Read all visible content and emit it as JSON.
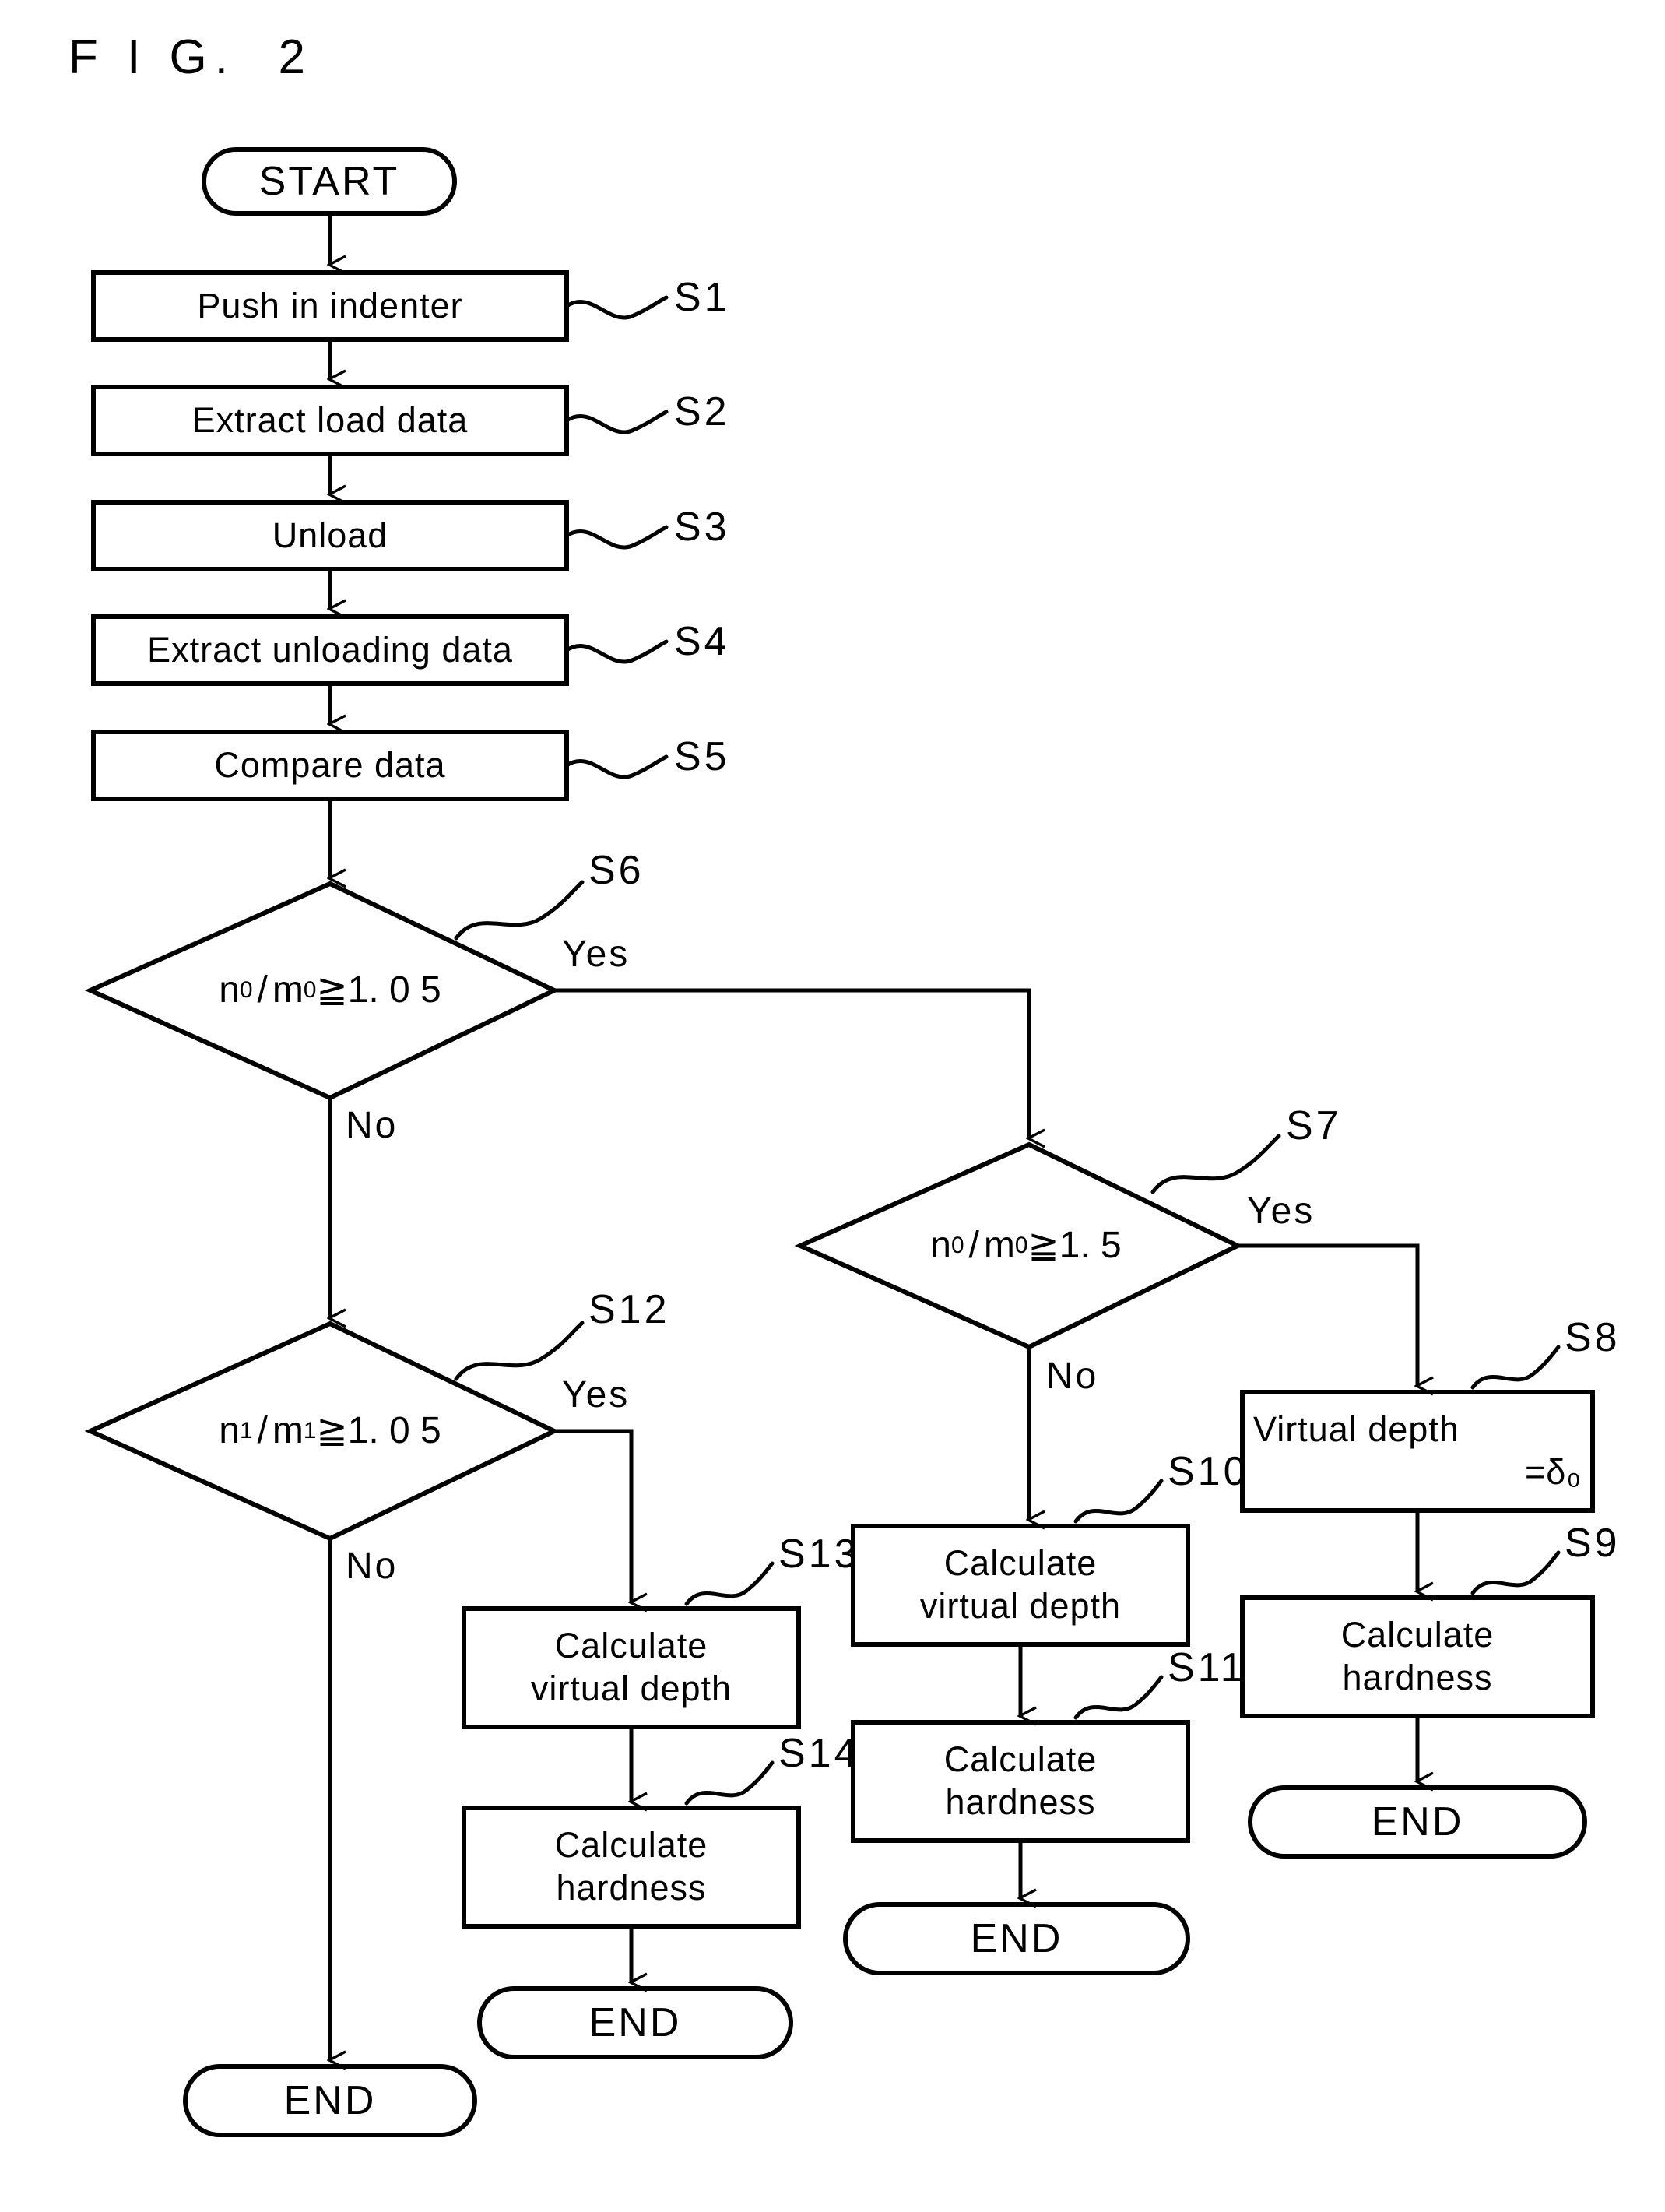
{
  "figure": {
    "title": "F I G.  2"
  },
  "diagram": {
    "type": "flowchart",
    "terminators": [
      {
        "id": "start",
        "label": "START"
      },
      {
        "id": "end_left",
        "label": "END"
      },
      {
        "id": "end_s14",
        "label": "END"
      },
      {
        "id": "end_s11",
        "label": "END"
      },
      {
        "id": "end_s9",
        "label": "END"
      }
    ],
    "process_nodes": [
      {
        "id": "s1",
        "step": "S1",
        "lines": [
          "Push in indenter"
        ]
      },
      {
        "id": "s2",
        "step": "S2",
        "lines": [
          "Extract load data"
        ]
      },
      {
        "id": "s3",
        "step": "S3",
        "lines": [
          "Unload"
        ]
      },
      {
        "id": "s4",
        "step": "S4",
        "lines": [
          "Extract unloading data"
        ]
      },
      {
        "id": "s5",
        "step": "S5",
        "lines": [
          "Compare data"
        ]
      },
      {
        "id": "s8",
        "step": "S8",
        "lines": [
          "Virtual depth",
          "=δ₀"
        ]
      },
      {
        "id": "s9",
        "step": "S9",
        "lines": [
          "Calculate",
          "hardness"
        ]
      },
      {
        "id": "s10",
        "step": "S10",
        "lines": [
          "Calculate",
          "virtual depth"
        ]
      },
      {
        "id": "s11",
        "step": "S11",
        "lines": [
          "Calculate",
          "hardness"
        ]
      },
      {
        "id": "s13",
        "step": "S13",
        "lines": [
          "Calculate",
          "virtual depth"
        ]
      },
      {
        "id": "s14",
        "step": "S14",
        "lines": [
          "Calculate",
          "hardness"
        ]
      }
    ],
    "decision_nodes": [
      {
        "id": "s6",
        "step": "S6",
        "num": "n",
        "num_sub": "0",
        "den": "m",
        "den_sub": "0",
        "op": "≧",
        "value": "1.  0 5",
        "yes": "Yes",
        "no": "No"
      },
      {
        "id": "s7",
        "step": "S7",
        "num": "n",
        "num_sub": "0",
        "den": "m",
        "den_sub": "0",
        "op": "≧",
        "value": "1.  5",
        "yes": "Yes",
        "no": "No"
      },
      {
        "id": "s12",
        "step": "S12",
        "num": "n",
        "num_sub": "1",
        "den": "m",
        "den_sub": "1",
        "op": "≧",
        "value": "1.  0 5",
        "yes": "Yes",
        "no": "No"
      }
    ],
    "edges": [
      {
        "from": "start",
        "to": "s1",
        "label": ""
      },
      {
        "from": "s1",
        "to": "s2",
        "label": ""
      },
      {
        "from": "s2",
        "to": "s3",
        "label": ""
      },
      {
        "from": "s3",
        "to": "s4",
        "label": ""
      },
      {
        "from": "s4",
        "to": "s5",
        "label": ""
      },
      {
        "from": "s5",
        "to": "s6",
        "label": ""
      },
      {
        "from": "s6",
        "to": "s7",
        "label": "Yes"
      },
      {
        "from": "s6",
        "to": "s12",
        "label": "No"
      },
      {
        "from": "s7",
        "to": "s8",
        "label": "Yes"
      },
      {
        "from": "s7",
        "to": "s10",
        "label": "No"
      },
      {
        "from": "s8",
        "to": "s9",
        "label": ""
      },
      {
        "from": "s9",
        "to": "end_s9",
        "label": ""
      },
      {
        "from": "s10",
        "to": "s11",
        "label": ""
      },
      {
        "from": "s11",
        "to": "end_s11",
        "label": ""
      },
      {
        "from": "s12",
        "to": "s13",
        "label": "Yes"
      },
      {
        "from": "s12",
        "to": "end_left",
        "label": "No"
      },
      {
        "from": "s13",
        "to": "s14",
        "label": ""
      },
      {
        "from": "s14",
        "to": "end_s14",
        "label": ""
      }
    ],
    "step_labels": [
      {
        "id": "lbl_s1",
        "text": "S1"
      },
      {
        "id": "lbl_s2",
        "text": "S2"
      },
      {
        "id": "lbl_s3",
        "text": "S3"
      },
      {
        "id": "lbl_s4",
        "text": "S4"
      },
      {
        "id": "lbl_s5",
        "text": "S5"
      },
      {
        "id": "lbl_s6",
        "text": "S6"
      },
      {
        "id": "lbl_s7",
        "text": "S7"
      },
      {
        "id": "lbl_s8",
        "text": "S8"
      },
      {
        "id": "lbl_s9",
        "text": "S9"
      },
      {
        "id": "lbl_s10",
        "text": "S10"
      },
      {
        "id": "lbl_s11",
        "text": "S11"
      },
      {
        "id": "lbl_s12",
        "text": "S12"
      },
      {
        "id": "lbl_s13",
        "text": "S13"
      },
      {
        "id": "lbl_s14",
        "text": "S14"
      }
    ],
    "branch_labels": [
      {
        "id": "yes_s6",
        "text": "Yes"
      },
      {
        "id": "no_s6",
        "text": "No"
      },
      {
        "id": "yes_s7",
        "text": "Yes"
      },
      {
        "id": "no_s7",
        "text": "No"
      },
      {
        "id": "yes_s12",
        "text": "Yes"
      },
      {
        "id": "no_s12",
        "text": "No"
      }
    ],
    "colors": {
      "stroke": "#000000",
      "fill": "#ffffff",
      "background": "#ffffff"
    }
  }
}
